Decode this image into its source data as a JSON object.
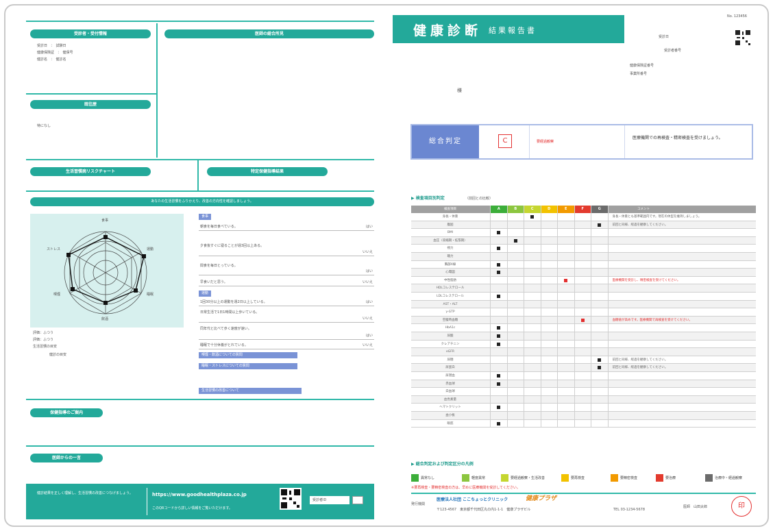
{
  "left": {
    "sec_personal": "受診者・受付情報",
    "personal_lines": [
      "受診日　：　試験日",
      "健康保険証　：　健保号",
      "健診名　：　健診名"
    ],
    "sec_doctor": "医師の総合所見",
    "sec_history": "既往歴",
    "history_value": "特になし",
    "sec_left_bottom": "生活習慣病リスクチャート",
    "sec_right_bottom": "特定保健指導結果",
    "band_title": "あなたの生活習慣をふりかえり、改善の方向性を確認しましょう。",
    "radar_labels": [
      "食事",
      "運動",
      "睡眠",
      "飲酒",
      "喫煙",
      "ストレス"
    ],
    "radar_notes": [
      "評価：ふつう　",
      "評価：ふつう",
      "生活習慣の目安",
      "健診の目安"
    ],
    "q_categories": [
      "食事",
      "運動"
    ],
    "questions": [
      {
        "text": "朝食を毎日食べている。",
        "ans": "はい"
      },
      {
        "text": "夕食後すぐに寝ることが週3回以上ある。",
        "ans": "いいえ"
      },
      {
        "text": "間食を毎日とっている。",
        "ans": "はい"
      },
      {
        "text": "早食いだと思う。",
        "ans": "いいえ"
      },
      {
        "text": "1回30分以上の運動を週2日以上している。",
        "ans": "はい"
      },
      {
        "text": "日常生活で1日1時間以上歩いている。",
        "ans": "いいえ"
      },
      {
        "text": "同年代と比べて歩く速度が速い。",
        "ans": "はい"
      },
      {
        "text": "睡眠で十分休養がとれている。",
        "ans": "いいえ"
      }
    ],
    "blue_bands": [
      "喫煙・飲酒についての質問",
      "睡眠・ストレスについての質問",
      "生活習慣の改善について"
    ],
    "sec_advice": "保健指導のご案内",
    "sec_notes": "医師からの一言",
    "footer_text": "健診結果を正しく理解し、生活習慣の改善につなげましょう。",
    "footer_url": "https://www.goodhealthplaza.co.jp",
    "footer_small": "このQRコードから詳しい情報をご覧いただけます。",
    "footer_box_label": "受診者ID"
  },
  "right": {
    "title_main": "健康診断",
    "title_sub": "結果報告書",
    "corner_code": "No. 123456",
    "meta_lines": [
      "受診日",
      "受診者番号"
    ],
    "meta_lines2": [
      "健康保険証番号",
      "事業所番号"
    ],
    "honorific": "様",
    "sogo_label": "総合判定",
    "sogo_grade": "C",
    "sogo_grade_text": "要経過観察",
    "sogo_comment": "医療機関での再検査・精密検査を受けましょう。",
    "table_heading": "検査項目別判定",
    "table_heading_sub": "（前回との比較）",
    "col_item": "検査項目",
    "grades": [
      {
        "label": "A",
        "color": "#3cae3a"
      },
      {
        "label": "B",
        "color": "#8cc63f"
      },
      {
        "label": "C",
        "color": "#c5d630"
      },
      {
        "label": "D",
        "color": "#f2c200"
      },
      {
        "label": "E",
        "color": "#f29a00"
      },
      {
        "label": "F",
        "color": "#e33b2e"
      },
      {
        "label": "G",
        "color": "#6b6b6b"
      }
    ],
    "col_comment": "コメント",
    "rows": [
      {
        "label": "身長・体重",
        "g": 2,
        "c": "身長・体重とも基準範囲内です。現在の体型を維持しましょう。",
        "red": false
      },
      {
        "label": "腹囲",
        "g": 6,
        "c": "前回と同様、経過を観察してください。",
        "red": false
      },
      {
        "label": "BMI",
        "g": 0,
        "c": "",
        "red": false
      },
      {
        "label": "血圧（収縮期・拡張期）",
        "g": 1,
        "c": "",
        "red": false
      },
      {
        "label": "視力",
        "g": 0,
        "c": "",
        "red": false
      },
      {
        "label": "聴力",
        "g": -1,
        "c": "",
        "red": false
      },
      {
        "label": "胸部X線",
        "g": 0,
        "c": "",
        "red": false
      },
      {
        "label": "心電図",
        "g": 0,
        "c": "",
        "red": false
      },
      {
        "label": "中性脂肪",
        "g": 4,
        "c": "医療機関を受診し、精密検査を受けてください。",
        "red": true
      },
      {
        "label": "HDLコレステロール",
        "g": -1,
        "c": "",
        "red": false
      },
      {
        "label": "LDLコレステロール",
        "g": 0,
        "c": "",
        "red": false
      },
      {
        "label": "AST・ALT",
        "g": -1,
        "c": "",
        "red": false
      },
      {
        "label": "γ-GTP",
        "g": -1,
        "c": "",
        "red": false
      },
      {
        "label": "空腹時血糖",
        "g": 5,
        "c": "血糖値が高めです。医療機関で再検査を受けてください。",
        "red": true
      },
      {
        "label": "HbA1c",
        "g": 0,
        "c": "",
        "red": false
      },
      {
        "label": "尿酸",
        "g": 0,
        "c": "",
        "red": false
      },
      {
        "label": "クレアチニン",
        "g": 0,
        "c": "",
        "red": false
      },
      {
        "label": "eGFR",
        "g": -1,
        "c": "",
        "red": false
      },
      {
        "label": "尿糖",
        "g": 6,
        "c": "前回と同様、経過を観察してください。",
        "red": false
      },
      {
        "label": "尿蛋白",
        "g": 6,
        "c": "前回と同様、経過を観察してください。",
        "red": false
      },
      {
        "label": "尿潜血",
        "g": 0,
        "c": "",
        "red": false
      },
      {
        "label": "赤血球",
        "g": 0,
        "c": "",
        "red": false
      },
      {
        "label": "白血球",
        "g": -1,
        "c": "",
        "red": false
      },
      {
        "label": "血色素量",
        "g": -1,
        "c": "",
        "red": false
      },
      {
        "label": "ヘマトクリット",
        "g": 0,
        "c": "",
        "red": false
      },
      {
        "label": "血小板",
        "g": -1,
        "c": "",
        "red": false
      },
      {
        "label": "眼底",
        "g": 0,
        "c": "",
        "red": false
      }
    ],
    "legend_title": "総合判定および判定区分の凡例",
    "legend": [
      {
        "label": "異常なし",
        "color": "#3cae3a",
        "letter": "A"
      },
      {
        "label": "軽度異常",
        "color": "#8cc63f",
        "letter": "B"
      },
      {
        "label": "要経過観察・生活改善",
        "color": "#c5d630",
        "letter": "C"
      },
      {
        "label": "要再検査",
        "color": "#f2c200",
        "letter": "D"
      },
      {
        "label": "要精密検査",
        "color": "#f29a00",
        "letter": "E"
      },
      {
        "label": "要治療",
        "color": "#e33b2e",
        "letter": "F"
      },
      {
        "label": "治療中・経過観察",
        "color": "#6b6b6b",
        "letter": "G"
      }
    ],
    "legend_note": "※要再検査・要精密検査の方は、早めに医療機関を受診してください。",
    "issuer_label": "発行機関",
    "issuer_name": "医療法人社団 ここちょっとクリニック",
    "issuer_brand": "健康プラザ",
    "issuer_address": "〒123-4567　東京都千代田区丸の内1-1-1　健康プラザビル",
    "issuer_tel": "TEL 03-1234-5678",
    "doctor_label": "医師　山田太郎",
    "stamp_text": "印"
  }
}
